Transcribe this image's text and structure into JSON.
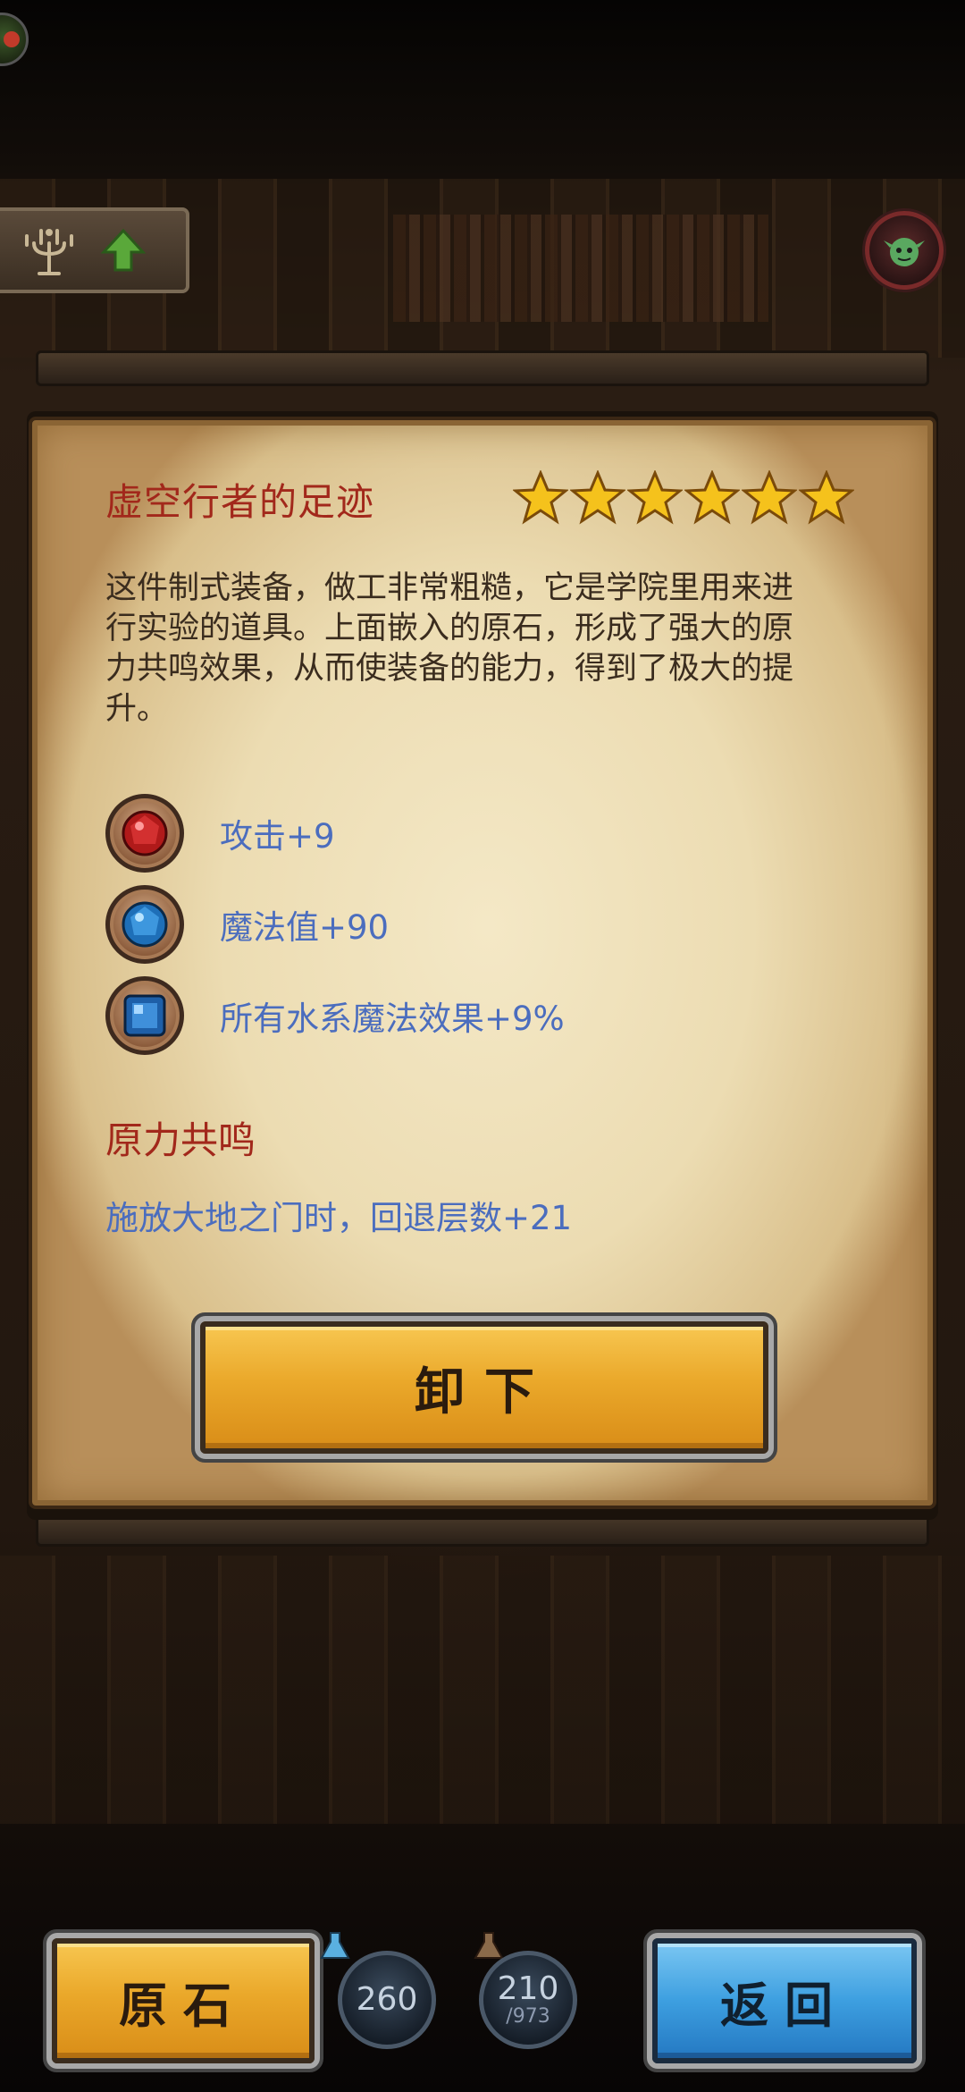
{
  "item": {
    "title": "虚空行者的足迹",
    "stars": 6,
    "description": "这件制式装备，做工非常粗糙，它是学院里用来进行实验的道具。上面嵌入的原石，形成了强大的原力共鸣效果，从而使装备的能力，得到了极大的提升。"
  },
  "stats": [
    {
      "gem": "red-gem-icon",
      "text": "攻击+9"
    },
    {
      "gem": "blue-round-gem-icon",
      "text": "魔法值+90"
    },
    {
      "gem": "blue-square-gem-icon",
      "text": "所有水系魔法效果+9%"
    }
  ],
  "resonance": {
    "title": "原力共鸣",
    "effect": "施放大地之门时，回退层数+21"
  },
  "buttons": {
    "unequip": "卸下",
    "gems": "原石",
    "back": "返回"
  },
  "counters": {
    "first": "260",
    "second": "210",
    "second_total": "/973"
  },
  "colors": {
    "title_red": "#a2281b",
    "stat_blue": "#4b6dbe",
    "button_gold": "#eaa82a",
    "button_blue": "#3d9fe0"
  }
}
